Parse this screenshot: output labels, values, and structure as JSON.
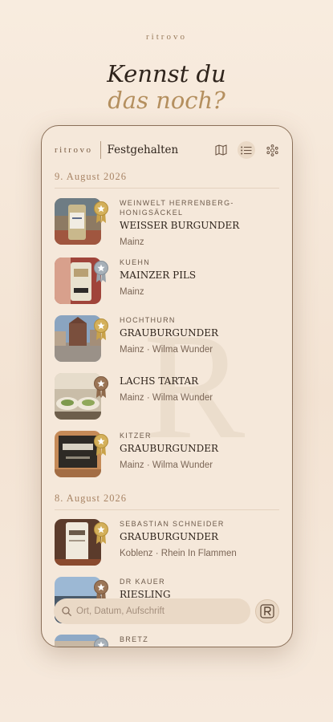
{
  "page": {
    "brand": "ritrovo",
    "headline_line1": "Kennst du",
    "headline_line2": "das noch?"
  },
  "app": {
    "logo": "ritrovo",
    "title": "Festgehalten",
    "icons": [
      "map-icon",
      "list-icon",
      "network-icon"
    ]
  },
  "search": {
    "placeholder": "Ort, Datum, Aufschrift"
  },
  "sections": [
    {
      "date": "9. August 2026",
      "entries": [
        {
          "producer": "WEINWELT HERRENBERG-\nHONIGSÄCKEL",
          "wine": "WEISSER BURGUNDER",
          "meta": "Mainz",
          "medal": "gold"
        },
        {
          "producer": "KUEHN",
          "wine": "MAINZER PILS",
          "meta": "Mainz",
          "medal": "silver"
        },
        {
          "producer": "HOCHTHURN",
          "wine": "GRAUBURGUNDER",
          "meta": "Mainz · Wilma Wunder",
          "medal": "gold"
        },
        {
          "producer": "",
          "wine": "LACHS TARTAR",
          "meta": "Mainz · Wilma Wunder",
          "medal": "bronze"
        },
        {
          "producer": "KITZER",
          "wine": "GRAUBURGUNDER",
          "meta": "Mainz · Wilma Wunder",
          "medal": "gold"
        }
      ]
    },
    {
      "date": "8. August 2026",
      "entries": [
        {
          "producer": "SEBASTIAN SCHNEIDER",
          "wine": "GRAUBURGUNDER",
          "meta": "Koblenz · Rhein In Flammen",
          "medal": "gold"
        },
        {
          "producer": "DR KAUER",
          "wine": "RIESLING",
          "meta": "",
          "medal": "bronze"
        },
        {
          "producer": "BRETZ",
          "wine": "",
          "meta": "",
          "medal": "silver"
        }
      ]
    }
  ],
  "colors": {
    "accent": "#b48f5e",
    "gold": "#c9a24a",
    "silver": "#9aa3ab",
    "bronze": "#8f6a4c"
  }
}
